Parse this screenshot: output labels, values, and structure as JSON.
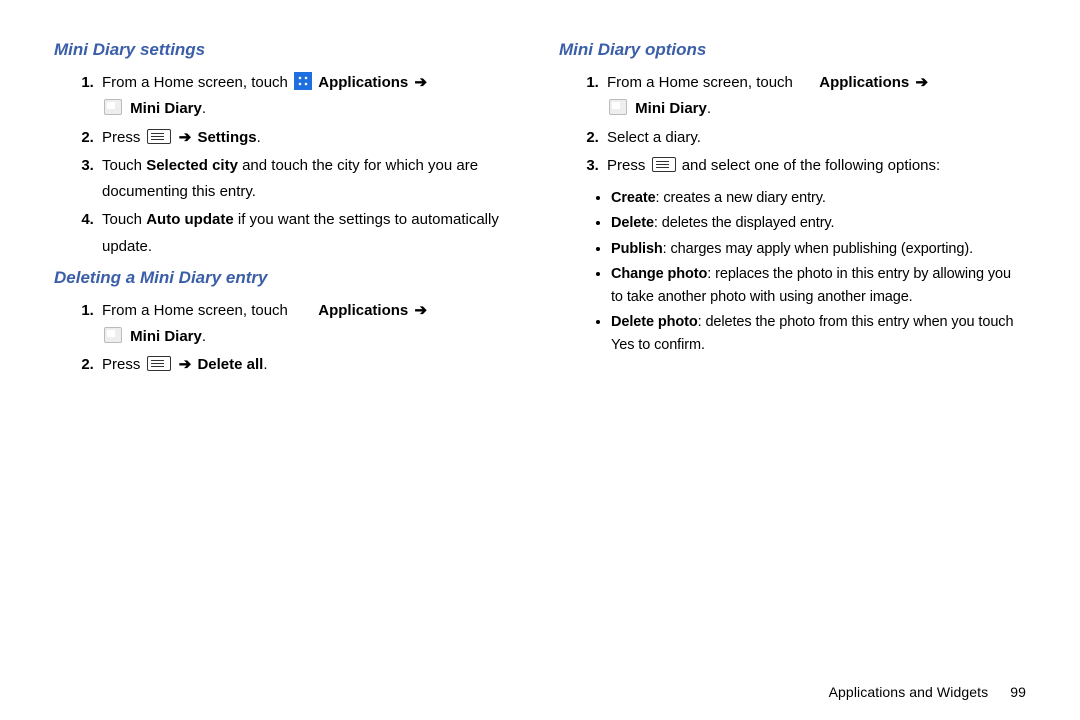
{
  "left": {
    "section1": {
      "heading": "Mini Diary settings",
      "s1_a": "From a Home screen, touch ",
      "s1_b": "Applications",
      "s1_c": "Mini Diary",
      "s2_a": "Press ",
      "s2_b": "Settings",
      "s3_a": "Touch ",
      "s3_b": "Selected city",
      "s3_c": " and touch the city for which you are documenting this entry.",
      "s4_a": "Touch ",
      "s4_b": "Auto update",
      "s4_c": " if you want the settings to automatically update."
    },
    "section2": {
      "heading": "Deleting a Mini Diary entry",
      "s1_a": "From a Home screen, touch ",
      "s1_b": "Applications",
      "s1_c": "Mini Diary",
      "s2_a": "Press ",
      "s2_b": "Delete all"
    }
  },
  "right": {
    "section1": {
      "heading": "Mini Diary options",
      "s1_a": "From a Home screen, touch ",
      "s1_b": "Applications",
      "s1_c": "Mini Diary",
      "s2": "Select a diary.",
      "s3_a": "Press ",
      "s3_b": " and select one of the following options:",
      "bullets": {
        "b1_a": "Create",
        "b1_b": ": creates a new diary entry.",
        "b2_a": "Delete",
        "b2_b": ": deletes the displayed entry.",
        "b3_a": "Publish",
        "b3_b": ": charges may apply when publishing (exporting).",
        "b4_a": "Change photo",
        "b4_b": ": replaces the photo in this entry by allowing you to take another photo with using another image.",
        "b5_a": "Delete photo",
        "b5_b": ": deletes the photo from this entry when you touch Yes to confirm."
      }
    }
  },
  "arrow": "➔",
  "period": ".",
  "footer": {
    "section": "Applications and Widgets",
    "page": "99"
  }
}
